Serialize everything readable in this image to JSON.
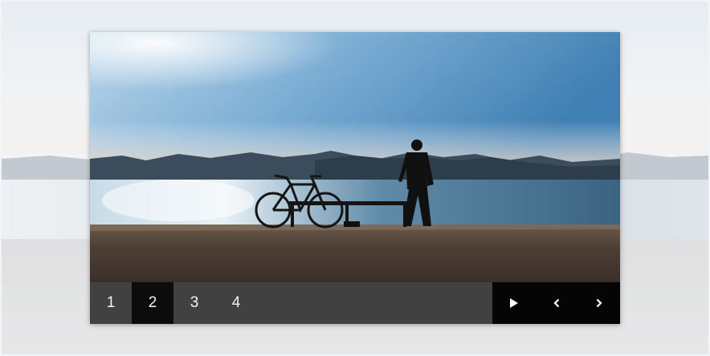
{
  "slider": {
    "pages": [
      "1",
      "2",
      "3",
      "4"
    ],
    "active_page": 2,
    "controls": {
      "play_icon": "play-icon",
      "prev_icon": "chevron-left-icon",
      "next_icon": "chevron-right-icon"
    },
    "colors": {
      "controls_bar": "#414141",
      "active_page_bg": "#0c0c0c",
      "buttons_bg": "#050505",
      "text": "#f2f2f2"
    }
  }
}
